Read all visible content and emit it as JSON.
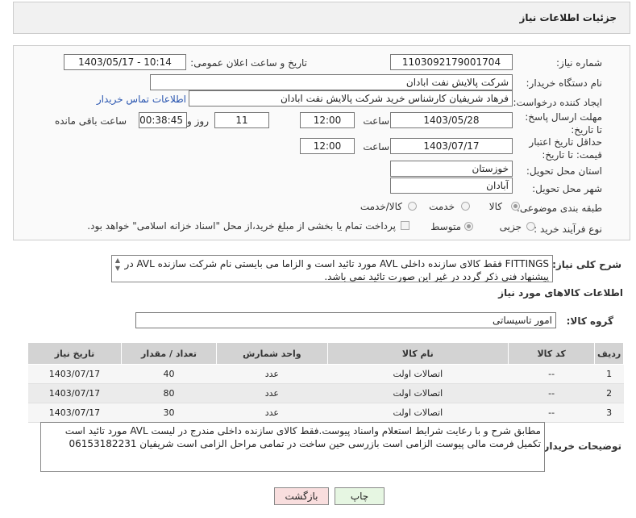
{
  "header": {
    "title": "جزئیات اطلاعات نیاز"
  },
  "form": {
    "need_number_label": "شماره نیاز:",
    "need_number": "1103092179001704",
    "announce_label": "تاریخ و ساعت اعلان عمومی:",
    "announce_value": "1403/05/17 - 10:14",
    "buyer_org_label": "نام دستگاه خریدار:",
    "buyer_org": "شرکت پالایش نفت ابادان",
    "creator_label": "ایجاد کننده درخواست:",
    "creator": "فرهاد شریفیان کارشناس خرید شرکت پالایش نفت ابادان",
    "contact_link": "اطلاعات تماس خریدار",
    "deadline_label": "مهلت ارسال پاسخ: تا تاریخ:",
    "deadline_date": "1403/05/28",
    "time_label": "ساعت",
    "deadline_time": "12:00",
    "days_value": "11",
    "days_label": "روز و",
    "remaining_time": "00:38:45",
    "remaining_label": "ساعت باقی مانده",
    "validity_label": "حداقل تاریخ اعتبار قیمت: تا تاریخ:",
    "validity_date": "1403/07/17",
    "validity_time": "12:00",
    "province_label": "استان محل تحویل:",
    "province": "خوزستان",
    "city_label": "شهر محل تحویل:",
    "city": "آبادان",
    "category_label": "طبقه بندی موضوعی:",
    "category_options": [
      "کالا",
      "خدمت",
      "کالا/خدمت"
    ],
    "purchase_type_label": "نوع فرآیند خرید :",
    "purchase_options": [
      "جزیی",
      "متوسط"
    ],
    "payment_note": "پرداخت تمام یا بخشی از مبلغ خرید،از محل \"اسناد خزانه اسلامی\" خواهد بود."
  },
  "description": {
    "label": "شرح کلی نیاز:",
    "text": "FITTINGS فقط کالای سازنده داخلی AVL مورد تائید است و الزاما می بایستی نام شرکت سازنده AVL در پیشنهاد فنی ذکر گردد در غیر این صورت تائید نمی باشد."
  },
  "goods": {
    "section_title": "اطلاعات کالاهای مورد نیاز",
    "group_label": "گروه کالا:",
    "group_value": "امور تاسیساتی",
    "columns": [
      "ردیف",
      "کد کالا",
      "نام کالا",
      "واحد شمارش",
      "تعداد / مقدار",
      "تاریخ نیاز"
    ],
    "rows": [
      [
        "1",
        "--",
        "اتصالات اولت",
        "عدد",
        "40",
        "1403/07/17"
      ],
      [
        "2",
        "--",
        "اتصالات اولت",
        "عدد",
        "80",
        "1403/07/17"
      ],
      [
        "3",
        "--",
        "اتصالات اولت",
        "عدد",
        "30",
        "1403/07/17"
      ]
    ]
  },
  "buyer_notes": {
    "label": "توضیحات خریدار:",
    "text": "مطابق شرح و با رعایت شرایط استعلام واسناد پیوست.فقط کالای سازنده داخلی مندرج در لیست AVL مورد تائید است تکمیل فرمت مالی پیوست الزامی است بازرسی حین ساخت در تمامی مراحل الزامی  است شریفیان 06153182231"
  },
  "buttons": {
    "print": "چاپ",
    "back": "بازگشت"
  },
  "colors": {
    "link": "#2a56b0",
    "back_button": "#f9dede",
    "print_button": "#e6f6e2"
  }
}
